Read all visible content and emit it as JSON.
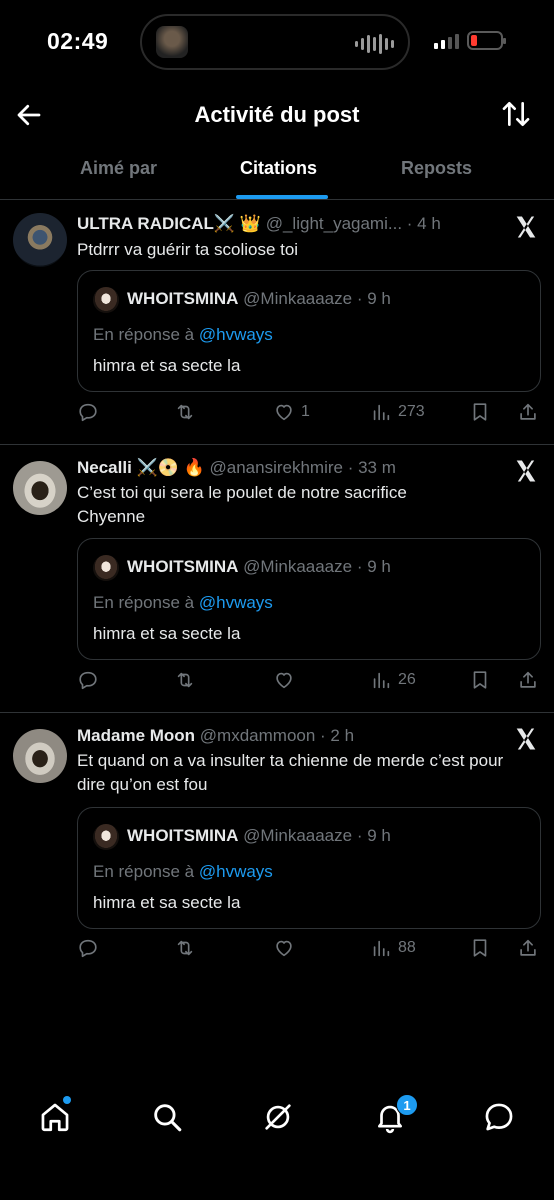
{
  "status_bar": {
    "time": "02:49",
    "battery_color": "#ff3b30"
  },
  "header": {
    "title": "Activité du post",
    "back_icon": "arrow-left-icon",
    "sort_icon": "sort-arrows-icon"
  },
  "tabs": [
    {
      "label": "Aimé par",
      "active": false
    },
    {
      "label": "Citations",
      "active": true
    },
    {
      "label": "Reposts",
      "active": false
    }
  ],
  "accent_color": "#1d9bf0",
  "posts": [
    {
      "name": "ULTRA RADICAL⚔️ 👑",
      "handle": "@_light_yagami... · 4 h",
      "text": "Ptdrrr va guérir ta scoliose toi",
      "quote": {
        "name": "WHOITSMINA",
        "handle": "@Minkaaaaze · 9 h",
        "reply_prefix": "En réponse à ",
        "reply_mention": "@hvways",
        "text": "himra et sa secte la"
      },
      "likes": "1",
      "views": "273"
    },
    {
      "name": "Necalli ⚔️📀 🔥",
      "handle": "@anansirekhmire · 33 m",
      "text": "C’est toi qui sera le poulet de notre sacrifice Chyenne",
      "quote": {
        "name": "WHOITSMINA",
        "handle": "@Minkaaaaze · 9 h",
        "reply_prefix": "En réponse à ",
        "reply_mention": "@hvways",
        "text": "himra et sa secte la"
      },
      "likes": "",
      "views": "26"
    },
    {
      "name": "Madame Moon",
      "handle": "@mxdammoon · 2 h",
      "text": "Et quand on a va insulter ta chienne de merde c’est pour dire qu’on est fou",
      "quote": {
        "name": "WHOITSMINA",
        "handle": "@Minkaaaaze · 9 h",
        "reply_prefix": "En réponse à ",
        "reply_mention": "@hvways",
        "text": "himra et sa secte la"
      },
      "likes": "",
      "views": "88"
    }
  ],
  "bottom_nav": {
    "items": [
      "home-icon",
      "search-icon",
      "grok-icon",
      "bell-icon",
      "messages-icon"
    ],
    "notification_count": "1"
  }
}
